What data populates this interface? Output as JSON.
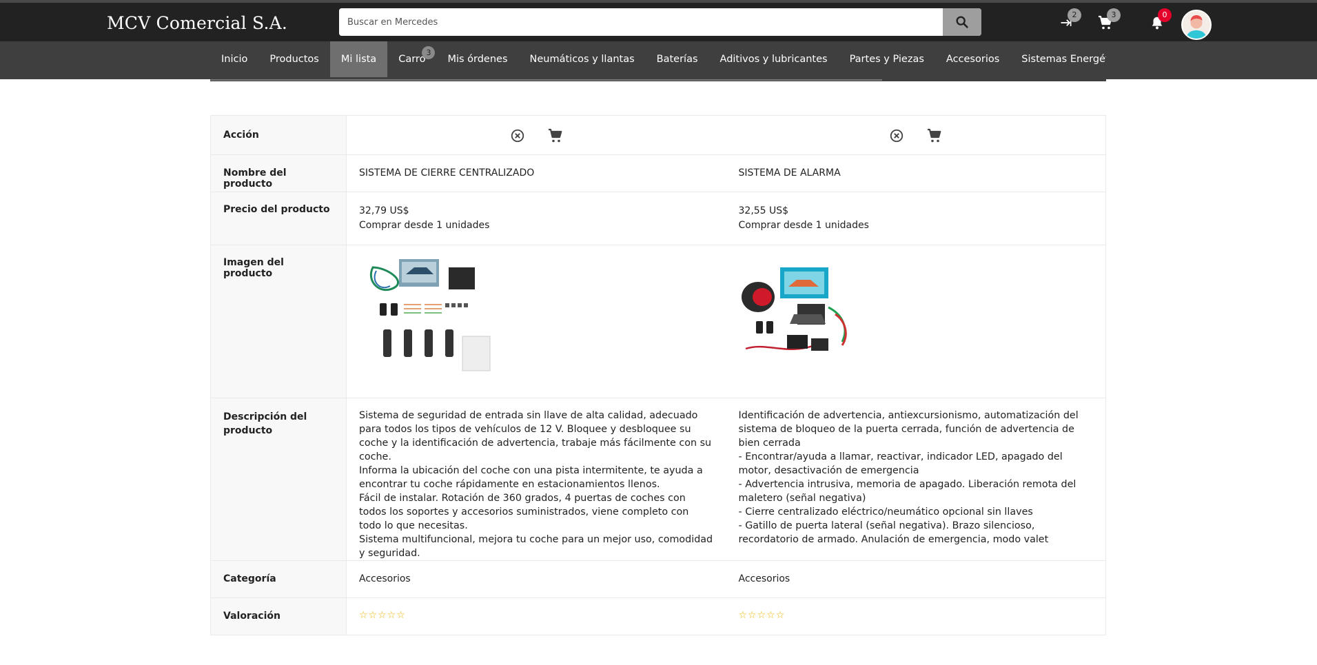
{
  "header": {
    "brand": "MCV Comercial S.A.",
    "search_placeholder": "Buscar en Mercedes",
    "compare_count": "2",
    "cart_count": "3",
    "notifications_count": "0"
  },
  "nav": {
    "items": [
      "Inicio",
      "Productos",
      "Mi lista",
      "Carro",
      "Mis órdenes",
      "Neumáticos y llantas",
      "Baterías",
      "Aditivos y lubricantes",
      "Partes y Piezas",
      "Accesorios",
      "Sistemas Energéticos"
    ],
    "active": "Mi lista",
    "cart_badge": "3"
  },
  "compare": {
    "labels": {
      "action": "Acción",
      "name": "Nombre del producto",
      "price": "Precio del producto",
      "image": "Imagen del producto",
      "description": "Descripción del producto",
      "category": "Categoría",
      "rating": "Valoración"
    },
    "products": [
      {
        "name": "SISTEMA DE CIERRE CENTRALIZADO",
        "price": "32,79 US$",
        "min_qty": "Comprar desde 1 unidades",
        "image": "central-locking-kit",
        "description": [
          "Sistema de seguridad de entrada sin llave de alta calidad, adecuado para todos los tipos de vehículos de 12 V. Bloquee y desbloquee su coche y la identificación de advertencia, trabaje más fácilmente con su coche.",
          "Informa la ubicación del coche con una pista intermitente, te ayuda a encontrar tu coche rápidamente en estacionamientos llenos.",
          "Fácil de instalar. Rotación de 360 grados, 4 puertas de coches con todos los soportes y accesorios suministrados, viene completo con todo lo que necesitas.",
          "Sistema multifuncional, mejora tu coche para un mejor uso, comodidad y seguridad."
        ],
        "category": "Accesorios",
        "rating": 0,
        "stars": "☆☆☆☆☆"
      },
      {
        "name": "SISTEMA DE ALARMA",
        "price": "32,55 US$",
        "min_qty": "Comprar desde 1 unidades",
        "image": "car-alarm-kit",
        "description": [
          " Identificación de advertencia, antiexcursionismo, automatización del sistema de bloqueo de la puerta cerrada, función de advertencia de bien cerrada",
          "- Encontrar/ayuda a llamar, reactivar, indicador LED, apagado del motor, desactivación de emergencia",
          "- Advertencia intrusiva, memoria de apagado. Liberación remota del maletero (señal negativa)",
          "- Cierre centralizado eléctrico/neumático opcional sin llaves",
          "- Gatillo de puerta lateral (señal negativa). Brazo silencioso, recordatorio de armado. Anulación de emergencia, modo valet"
        ],
        "category": "Accesorios",
        "rating": 0,
        "stars": "☆☆☆☆☆"
      }
    ]
  }
}
